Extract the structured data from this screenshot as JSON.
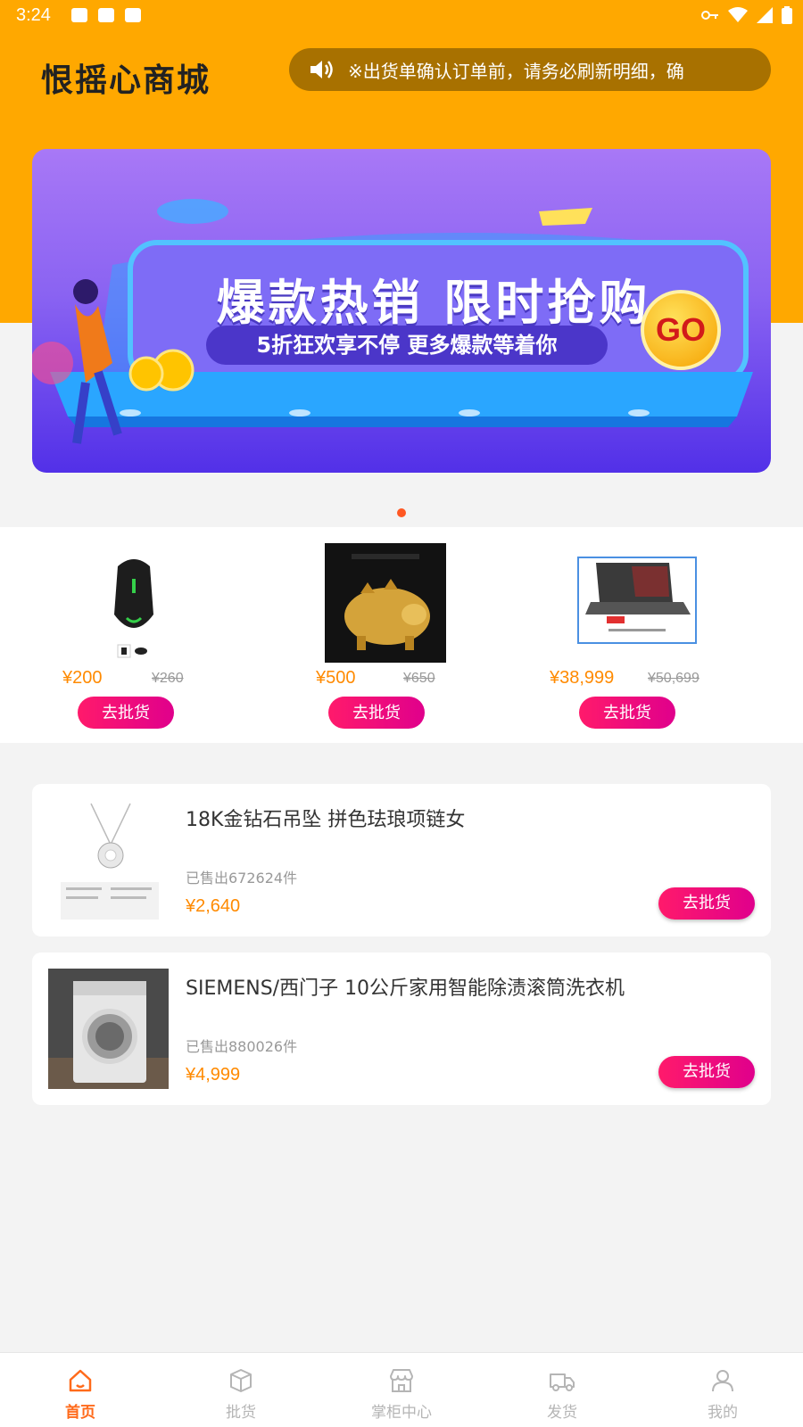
{
  "status_bar": {
    "time": "3:24"
  },
  "header": {
    "logo_text": "恨摇心商城",
    "notice_text": "※出货单确认订单前，请务必刷新明细，确"
  },
  "banner": {
    "title": "爆款热销 限时抢购",
    "subtitle": "5折狂欢享不停 更多爆款等着你",
    "go_label": "GO"
  },
  "colors": {
    "brand_orange": "#ffa800",
    "price": "#ff8a00",
    "button_pink": "#ff1a6b",
    "tab_active": "#ff6a1a"
  },
  "hot_products": [
    {
      "icon": "mouse-image",
      "price": "¥200",
      "original_price": "¥260",
      "button": "去批货"
    },
    {
      "icon": "gold-pig-image",
      "price": "¥500",
      "original_price": "¥650",
      "button": "去批货"
    },
    {
      "icon": "laptop-image",
      "price": "¥38,999",
      "original_price": "¥50,699",
      "button": "去批货"
    }
  ],
  "product_list": [
    {
      "icon": "necklace-image",
      "title": "18K金钻石吊坠 拼色珐琅项链女",
      "sold": "已售出672624件",
      "price": "¥2,640",
      "button": "去批货"
    },
    {
      "icon": "washing-machine-image",
      "title": "SIEMENS/西门子 10公斤家用智能除渍滚筒洗衣机",
      "sold": "已售出880026件",
      "price": "¥4,999",
      "button": "去批货"
    }
  ],
  "tabbar": [
    {
      "label": "首页",
      "icon": "home-icon",
      "active": true
    },
    {
      "label": "批货",
      "icon": "box-icon",
      "active": false
    },
    {
      "label": "掌柜中心",
      "icon": "store-icon",
      "active": false
    },
    {
      "label": "发货",
      "icon": "truck-icon",
      "active": false
    },
    {
      "label": "我的",
      "icon": "user-icon",
      "active": false
    }
  ]
}
